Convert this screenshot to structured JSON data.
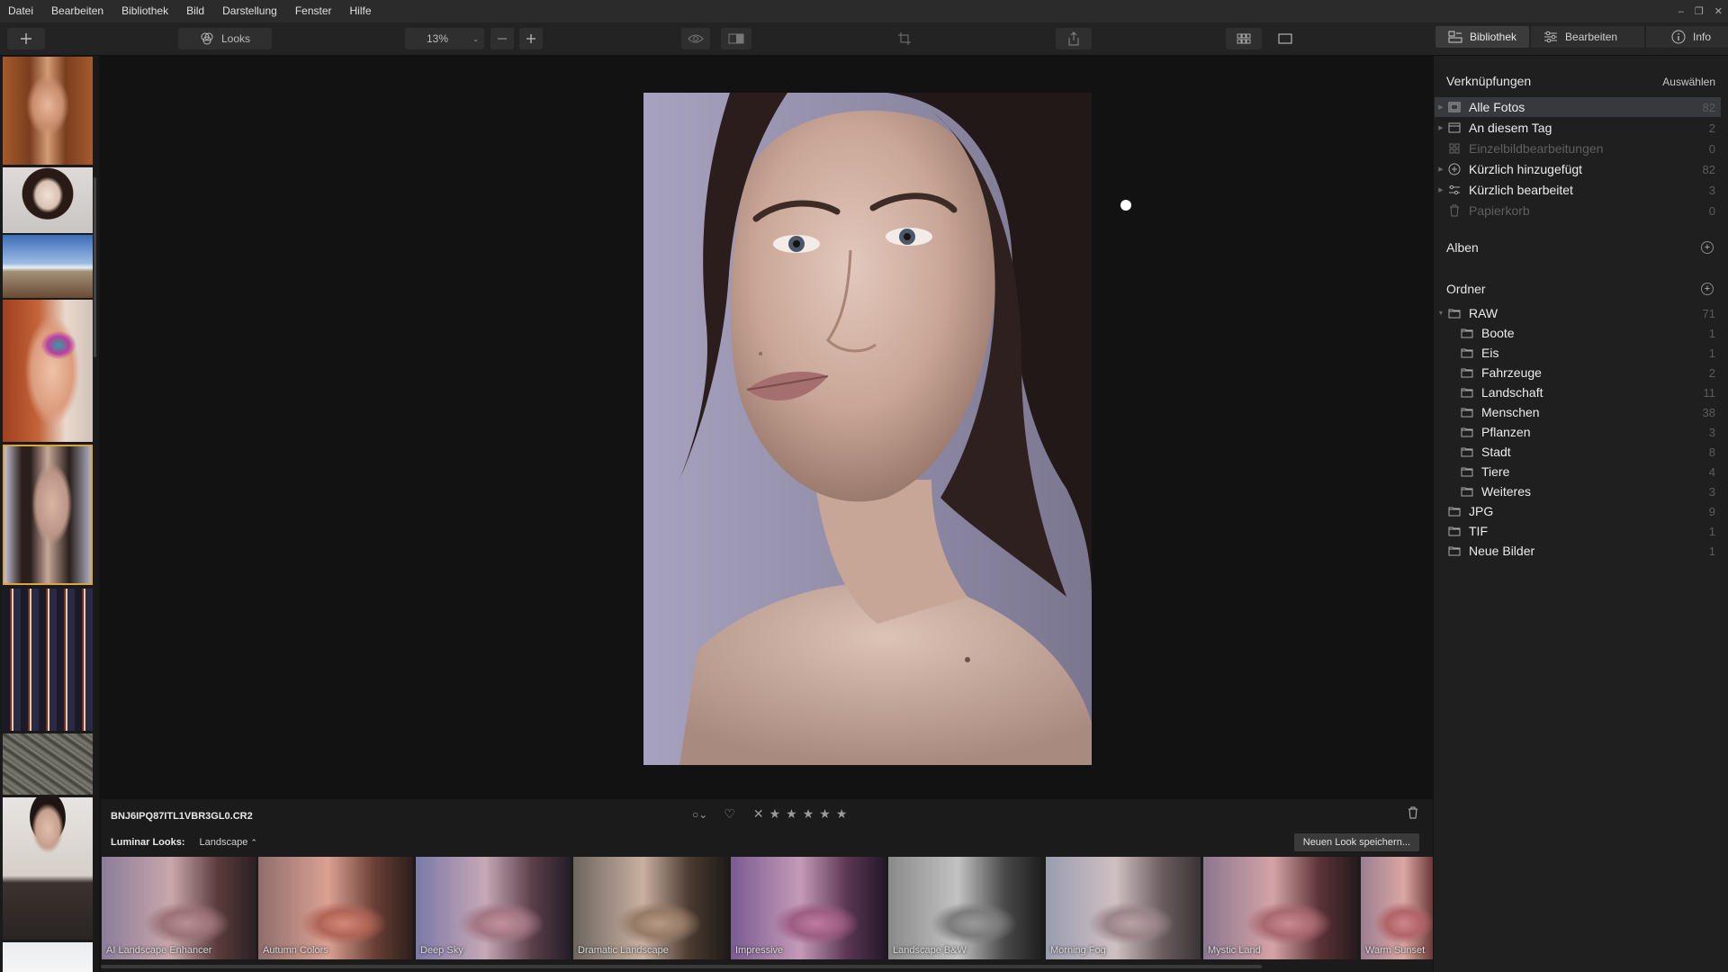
{
  "menu": [
    "Datei",
    "Bearbeiten",
    "Bibliothek",
    "Bild",
    "Darstellung",
    "Fenster",
    "Hilfe"
  ],
  "toolbar": {
    "looks_label": "Looks",
    "zoom_value": "13%"
  },
  "tabs": [
    {
      "label": "Bibliothek",
      "icon": "library-icon"
    },
    {
      "label": "Bearbeiten",
      "icon": "sliders-icon"
    },
    {
      "label": "Info",
      "icon": "info-icon"
    }
  ],
  "sidebar": {
    "shortcuts_title": "Verknüpfungen",
    "shortcuts_action": "Auswählen",
    "shortcuts": [
      {
        "label": "Alle Fotos",
        "count": "82",
        "icon": "photos-icon"
      },
      {
        "label": "An diesem Tag",
        "count": "2",
        "icon": "calendar-icon"
      },
      {
        "label": "Einzelbildbearbeitungen",
        "count": "0",
        "icon": "grid-icon"
      },
      {
        "label": "Kürzlich hinzugefügt",
        "count": "82",
        "icon": "plus-circle-icon"
      },
      {
        "label": "Kürzlich bearbeitet",
        "count": "3",
        "icon": "sliders-icon"
      },
      {
        "label": "Papierkorb",
        "count": "0",
        "icon": "trash-icon"
      }
    ],
    "albums_title": "Alben",
    "folders_title": "Ordner",
    "folders": [
      {
        "label": "RAW",
        "count": "71"
      },
      {
        "label": "Boote",
        "count": "1"
      },
      {
        "label": "Eis",
        "count": "1"
      },
      {
        "label": "Fahrzeuge",
        "count": "2"
      },
      {
        "label": "Landschaft",
        "count": "11"
      },
      {
        "label": "Menschen",
        "count": "38"
      },
      {
        "label": "Pflanzen",
        "count": "3"
      },
      {
        "label": "Stadt",
        "count": "8"
      },
      {
        "label": "Tiere",
        "count": "4"
      },
      {
        "label": "Weiteres",
        "count": "3"
      },
      {
        "label": "JPG",
        "count": "9"
      },
      {
        "label": "TIF",
        "count": "1"
      },
      {
        "label": "Neue Bilder",
        "count": "1"
      }
    ]
  },
  "image": {
    "filename": "BNJ6IPQ87ITL1VBR3GL0.CR2",
    "stars": 5
  },
  "looks": {
    "heading": "Luminar Looks:",
    "category": "Landscape",
    "save_label": "Neuen Look speichern...",
    "items": [
      "AI Landscape Enhancer",
      "Autumn Colors",
      "Deep Sky",
      "Dramatic Landscape",
      "Impressive",
      "Landscape B&W",
      "Morning Fog",
      "Mystic Land",
      "Warm Sunset"
    ]
  },
  "colors": {
    "accent": "#d9a441",
    "panel": "#1f1f1f",
    "highlight": "#38393d"
  }
}
